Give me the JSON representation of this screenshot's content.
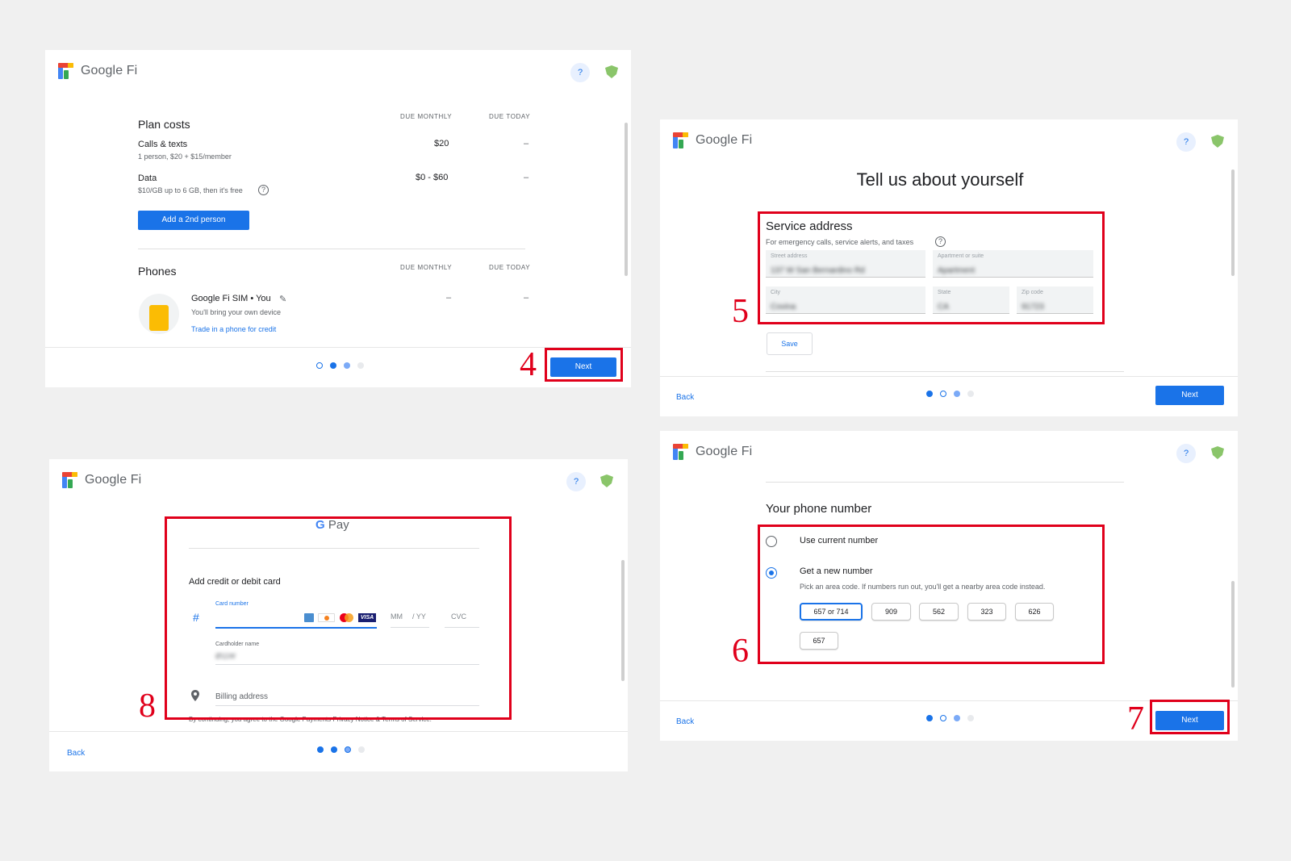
{
  "colors": {
    "accent": "#1a73e8",
    "annotation_red": "#e0001b",
    "page_bg": "#f0f0f0"
  },
  "brand": {
    "name": "Google Fi"
  },
  "help_label": "?",
  "common": {
    "next": "Next",
    "back": "Back"
  },
  "step_numbers": {
    "s4": "4",
    "s5": "5",
    "s6": "6",
    "s7": "7",
    "s8": "8"
  },
  "plan_panel": {
    "plan_costs_title": "Plan costs",
    "due_monthly": "DUE MONTHLY",
    "due_today": "DUE TODAY",
    "rows": [
      {
        "name": "Calls & texts",
        "detail": "1 person, $20 + $15/member",
        "monthly": "$20",
        "today": "–"
      },
      {
        "name": "Data",
        "detail": "$10/GB up to 6 GB, then it's free",
        "monthly": "$0 - $60",
        "today": "–"
      }
    ],
    "add_person": "Add a 2nd person",
    "phones_title": "Phones",
    "phone": {
      "name": "Google Fi SIM • You",
      "detail": "You'll bring your own device",
      "trade_in": "Trade in a phone for credit",
      "monthly": "–",
      "today": "–"
    }
  },
  "about_panel": {
    "title": "Tell us about yourself",
    "service_address": "Service address",
    "service_address_sub": "For emergency calls, service alerts, and taxes",
    "fields": {
      "street": {
        "label": "Street address",
        "value": "137 W San Bernardino Rd"
      },
      "apt": {
        "label": "Apartment or suite",
        "value": "Apartment"
      },
      "city": {
        "label": "City",
        "value": "Covina"
      },
      "state": {
        "label": "State",
        "value": "CA"
      },
      "zip": {
        "label": "Zip code",
        "value": "91723"
      }
    },
    "save": "Save"
  },
  "number_panel": {
    "title": "Your phone number",
    "use_current": "Use current number",
    "get_new": "Get a new number",
    "get_new_sub": "Pick an area code. If numbers run out, you'll get a nearby area code instead.",
    "area_codes": [
      "657 or 714",
      "909",
      "562",
      "323",
      "626",
      "657"
    ]
  },
  "pay_panel": {
    "gpay_g": "G",
    "gpay_pay": "Pay",
    "add_card": "Add credit or debit card",
    "card_number_label": "Card number",
    "hash": "#",
    "mm": "MM",
    "yy": "/ YY",
    "cvc": "CVC",
    "card_brands": [
      "AMEX",
      "DISCOVER",
      "MC",
      "VISA"
    ],
    "cardholder_label": "Cardholder name",
    "cardholder_value": "Ø11W",
    "billing_address": "Billing address",
    "terms": "By continuing, you agree to the Google Payments Privacy Notice & Terms of Service."
  }
}
